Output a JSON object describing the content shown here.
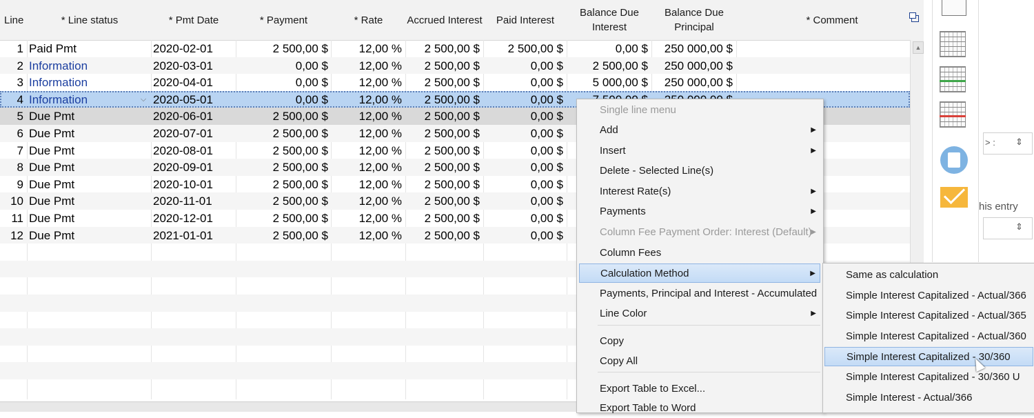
{
  "table": {
    "columns": [
      "Line",
      "* Line status",
      "* Pmt Date",
      "* Payment",
      "* Rate",
      "Accrued Interest",
      "Paid Interest",
      "Balance Due Interest",
      "Balance Due Principal",
      "* Comment"
    ],
    "rows": [
      {
        "line": "1",
        "status": "Paid Pmt",
        "date": "2020-02-01",
        "payment": "2 500,00 $",
        "rate": "12,00 %",
        "accrued": "2 500,00 $",
        "paid": "2 500,00 $",
        "bal_int": "0,00 $",
        "bal_prin": "250 000,00 $"
      },
      {
        "line": "2",
        "status": "Information",
        "date": "2020-03-01",
        "payment": "0,00 $",
        "rate": "12,00 %",
        "accrued": "2 500,00 $",
        "paid": "0,00 $",
        "bal_int": "2 500,00 $",
        "bal_prin": "250 000,00 $"
      },
      {
        "line": "3",
        "status": "Information",
        "date": "2020-04-01",
        "payment": "0,00 $",
        "rate": "12,00 %",
        "accrued": "2 500,00 $",
        "paid": "0,00 $",
        "bal_int": "5 000,00 $",
        "bal_prin": "250 000,00 $"
      },
      {
        "line": "4",
        "status": "Information",
        "date": "2020-05-01",
        "payment": "0,00 $",
        "rate": "12,00 %",
        "accrued": "2 500,00 $",
        "paid": "0,00 $",
        "bal_int": "7 500,00 $",
        "bal_prin": "250 000,00 $"
      },
      {
        "line": "5",
        "status": "Due Pmt",
        "date": "2020-06-01",
        "payment": "2 500,00 $",
        "rate": "12,00 %",
        "accrued": "2 500,00 $",
        "paid": "0,00 $",
        "bal_int": "",
        "bal_prin": ""
      },
      {
        "line": "6",
        "status": "Due Pmt",
        "date": "2020-07-01",
        "payment": "2 500,00 $",
        "rate": "12,00 %",
        "accrued": "2 500,00 $",
        "paid": "0,00 $",
        "bal_int": "",
        "bal_prin": ""
      },
      {
        "line": "7",
        "status": "Due Pmt",
        "date": "2020-08-01",
        "payment": "2 500,00 $",
        "rate": "12,00 %",
        "accrued": "2 500,00 $",
        "paid": "0,00 $",
        "bal_int": "",
        "bal_prin": ""
      },
      {
        "line": "8",
        "status": "Due Pmt",
        "date": "2020-09-01",
        "payment": "2 500,00 $",
        "rate": "12,00 %",
        "accrued": "2 500,00 $",
        "paid": "0,00 $",
        "bal_int": "",
        "bal_prin": ""
      },
      {
        "line": "9",
        "status": "Due Pmt",
        "date": "2020-10-01",
        "payment": "2 500,00 $",
        "rate": "12,00 %",
        "accrued": "2 500,00 $",
        "paid": "0,00 $",
        "bal_int": "",
        "bal_prin": ""
      },
      {
        "line": "10",
        "status": "Due Pmt",
        "date": "2020-11-01",
        "payment": "2 500,00 $",
        "rate": "12,00 %",
        "accrued": "2 500,00 $",
        "paid": "0,00 $",
        "bal_int": "",
        "bal_prin": ""
      },
      {
        "line": "11",
        "status": "Due Pmt",
        "date": "2020-12-01",
        "payment": "2 500,00 $",
        "rate": "12,00 %",
        "accrued": "2 500,00 $",
        "paid": "0,00 $",
        "bal_int": "",
        "bal_prin": ""
      },
      {
        "line": "12",
        "status": "Due Pmt",
        "date": "2021-01-01",
        "payment": "2 500,00 $",
        "rate": "12,00 %",
        "accrued": "2 500,00 $",
        "paid": "0,00 $",
        "bal_int": "",
        "bal_prin": ""
      }
    ]
  },
  "context_menu": {
    "items": [
      {
        "label": "Single line menu",
        "disabled": true,
        "submenu": false
      },
      {
        "label": "Add",
        "disabled": false,
        "submenu": true
      },
      {
        "label": "Insert",
        "disabled": false,
        "submenu": true
      },
      {
        "label": "Delete - Selected Line(s)",
        "disabled": false,
        "submenu": false
      },
      {
        "label": "Interest Rate(s)",
        "disabled": false,
        "submenu": true
      },
      {
        "label": "Payments",
        "disabled": false,
        "submenu": true
      },
      {
        "label": "Column Fee Payment Order: Interest (Default)",
        "disabled": true,
        "submenu": true
      },
      {
        "label": "Column Fees",
        "disabled": false,
        "submenu": false
      },
      {
        "label": "Calculation Method",
        "disabled": false,
        "submenu": true,
        "highlighted": true
      },
      {
        "label": "Payments, Principal and Interest - Accumulated",
        "disabled": false,
        "submenu": false
      },
      {
        "label": "Line Color",
        "disabled": false,
        "submenu": true
      },
      {
        "label": "Copy",
        "disabled": false,
        "submenu": false
      },
      {
        "label": "Copy All",
        "disabled": false,
        "submenu": false
      },
      {
        "label": "Export Table to Excel...",
        "disabled": false,
        "submenu": false
      },
      {
        "label": "Export Table to Word",
        "disabled": false,
        "submenu": false
      }
    ]
  },
  "submenu": {
    "items": [
      "Same as calculation",
      "Simple Interest Capitalized - Actual/366",
      "Simple Interest Capitalized - Actual/365",
      "Simple Interest Capitalized - Actual/360",
      "Simple Interest Capitalized - 30/360",
      "Simple Interest Capitalized - 30/360 U",
      "Simple Interest - Actual/366"
    ],
    "highlighted_index": 4
  },
  "side_panel": {
    "partial_text": "his entry",
    "spinner_partial": "> :"
  },
  "icons": [
    "document-icon",
    "calendar-icon",
    "calendar-green-icon",
    "calendar-red-icon",
    "calculator-icon",
    "mail-icon",
    "window-restore-icon",
    "cursor-icon"
  ],
  "colors": {
    "selection": "#b9d4f2",
    "info_text": "#1c3fa0",
    "menu_highlight": "#c3dbf6"
  }
}
